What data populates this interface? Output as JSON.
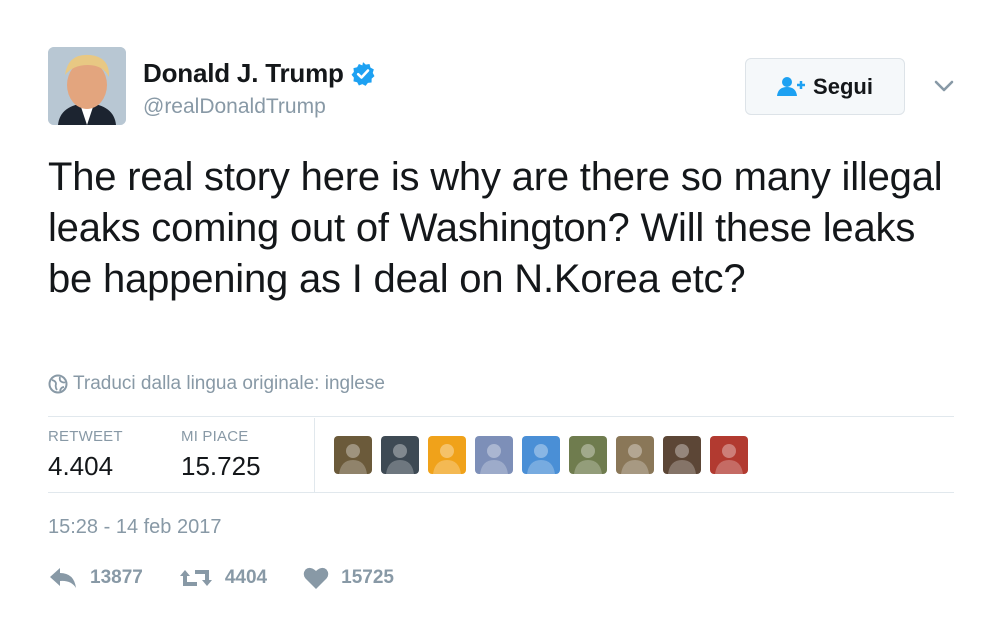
{
  "author": {
    "name": "Donald J. Trump",
    "handle": "@realDonaldTrump",
    "verified": true,
    "verified_color": "#1da1f2"
  },
  "follow_button": {
    "label": "Segui",
    "icon": "add-user-icon"
  },
  "menu": {
    "icon": "chevron-down-icon"
  },
  "tweet": {
    "text": "The real story here is why are there so many illegal leaks coming out of Washington? Will these leaks be happening as I deal on N.Korea etc?"
  },
  "translate": {
    "label": "Traduci dalla lingua originale: inglese",
    "icon": "globe-icon"
  },
  "stats": {
    "retweets": {
      "label": "RETWEET",
      "value": "4.404"
    },
    "likes": {
      "label": "MI PIACE",
      "value": "15.725"
    }
  },
  "likers": [
    {
      "icon": "user-avatar-1",
      "color": "#6b5a3a"
    },
    {
      "icon": "user-avatar-2",
      "color": "#3e4a54"
    },
    {
      "icon": "user-avatar-3",
      "color": "#f0a21a"
    },
    {
      "icon": "user-avatar-4",
      "color": "#7d8fb8"
    },
    {
      "icon": "user-avatar-5",
      "color": "#4a8fd6"
    },
    {
      "icon": "user-avatar-6",
      "color": "#6f7c4e"
    },
    {
      "icon": "user-avatar-7",
      "color": "#8a7758"
    },
    {
      "icon": "user-avatar-8",
      "color": "#5c4636"
    },
    {
      "icon": "user-avatar-9",
      "color": "#b23a30"
    }
  ],
  "timestamp": "15:28 - 14 feb 2017",
  "actions": {
    "reply": {
      "icon": "reply-icon",
      "count": "13877"
    },
    "retweet": {
      "icon": "retweet-icon",
      "count": "4404"
    },
    "like": {
      "icon": "heart-icon",
      "count": "15725"
    }
  },
  "colors": {
    "muted": "#8899a6",
    "text": "#14171a",
    "divider": "#e1e8ed",
    "accent": "#1da1f2"
  }
}
